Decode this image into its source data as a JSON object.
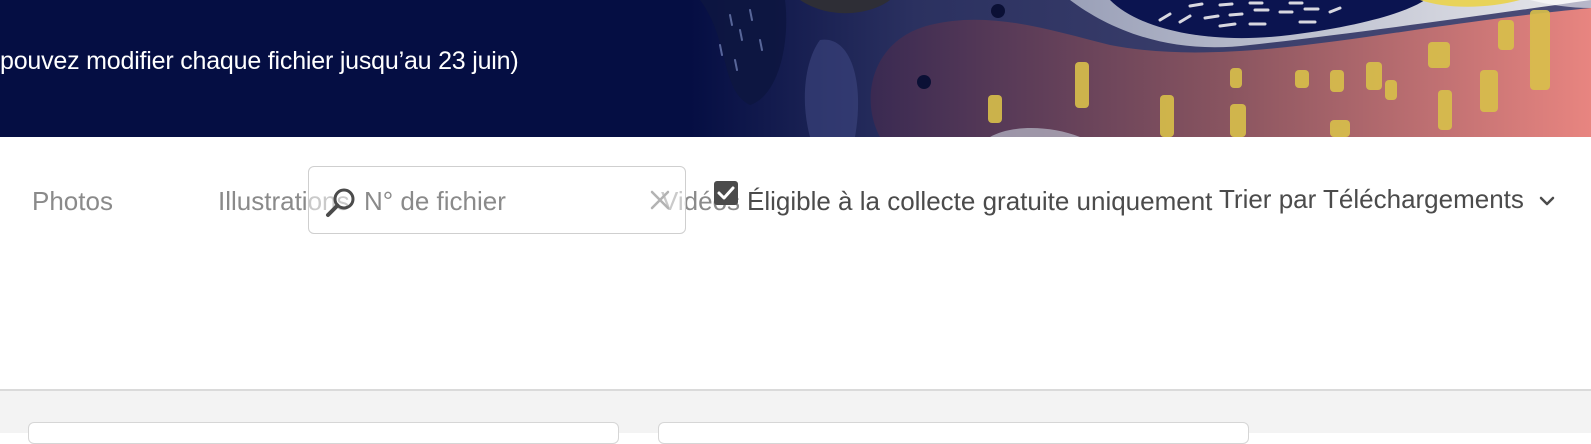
{
  "banner": {
    "text": "pouvez modifier chaque fichier jusqu’au 23 juin)"
  },
  "toolbar": {
    "tabs": [
      {
        "label": "Photos"
      },
      {
        "label": "Illustrations"
      },
      {
        "label": "Vidéos"
      }
    ],
    "search": {
      "placeholder": "N° de fichier",
      "value": "",
      "icon": "search-icon",
      "clear_icon": "close-icon"
    },
    "free_filter": {
      "label": "Éligible à la collecte gratuite uniquement",
      "checked": true
    },
    "sort": {
      "label": "Trier par Téléchargements",
      "icon": "chevron-down-icon"
    }
  },
  "colors": {
    "banner_bg": "#050e43",
    "banner_text": "#ffffff",
    "tab_text": "#8a8a8a",
    "body_text": "#4b4b4b",
    "lower_bg": "#f3f3f3"
  }
}
